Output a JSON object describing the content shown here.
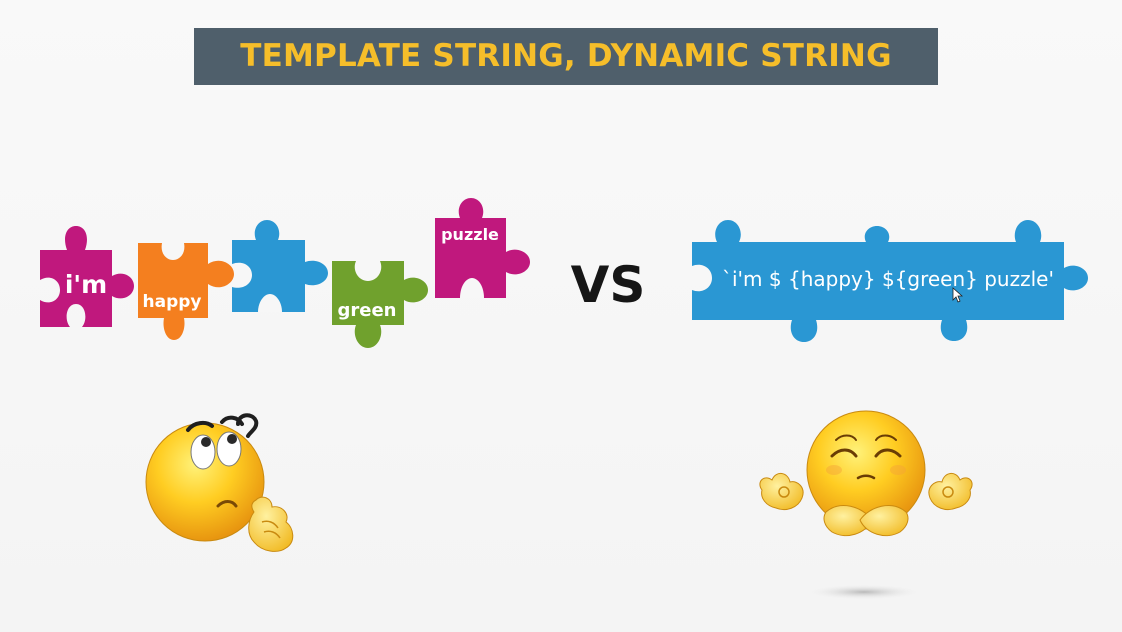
{
  "title": "TEMPLATE STRING, DYNAMIC STRING",
  "pieces": [
    {
      "label": "i'm",
      "color": "#c0187d"
    },
    {
      "label": "happy",
      "color": "#f47f1f"
    },
    {
      "label": "green",
      "color": "#70a12d"
    },
    {
      "label": "puzzle",
      "color": "#c0187d"
    }
  ],
  "unlabeled_piece_color": "#2a97d3",
  "vs": "VS",
  "template_string": "`i'm $ {happy} ${green} puzzle'",
  "template_color": "#2a97d3",
  "emojis": [
    {
      "icon": "thinking-face-icon"
    },
    {
      "icon": "meditating-face-icon"
    }
  ]
}
